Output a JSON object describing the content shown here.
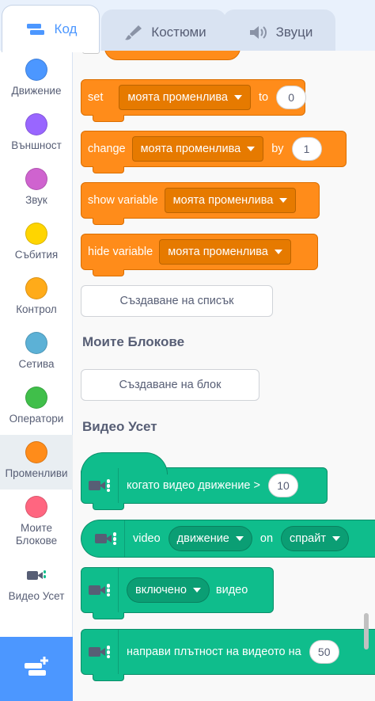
{
  "tabs": [
    {
      "label": "Код",
      "icon": "code-icon",
      "active": true
    },
    {
      "label": "Костюми",
      "icon": "brush-icon",
      "active": false
    },
    {
      "label": "Звуци",
      "icon": "speaker-icon",
      "active": false
    }
  ],
  "categories": [
    {
      "label": "Движение",
      "color": "#4c97ff"
    },
    {
      "label": "Външност",
      "color": "#9966ff"
    },
    {
      "label": "Звук",
      "color": "#cf63cf"
    },
    {
      "label": "Събития",
      "color": "#ffd500"
    },
    {
      "label": "Контрол",
      "color": "#ffab19"
    },
    {
      "label": "Сетива",
      "color": "#5cb1d6"
    },
    {
      "label": "Оператори",
      "color": "#40bf4a"
    },
    {
      "label": "Променливи",
      "color": "#ff8c1a"
    },
    {
      "label": "Моите Блокове",
      "color": "#ff6680"
    },
    {
      "label": "Видео Усет",
      "color": ""
    }
  ],
  "variable_blocks": {
    "set": {
      "keyword": "set",
      "variable": "моята променлива",
      "joiner": "to",
      "value": "0"
    },
    "change": {
      "keyword": "change",
      "variable": "моята променлива",
      "joiner": "by",
      "value": "1"
    },
    "show": {
      "keyword": "show variable",
      "variable": "моята променлива"
    },
    "hide": {
      "keyword": "hide variable",
      "variable": "моята променлива"
    }
  },
  "buttons": {
    "make_list": "Създаване на списък",
    "make_block": "Създаване на блок"
  },
  "headings": {
    "my_blocks": "Моите Блокове",
    "video_sensing": "Видео Усет"
  },
  "video_blocks": {
    "when_motion": {
      "text": "когато видео движение >",
      "value": "10"
    },
    "video_on": {
      "keyword": "video",
      "attribute": "движение",
      "joiner": "on",
      "target": "спрайт"
    },
    "turn_video": {
      "state": "включено",
      "suffix": "видео"
    },
    "transparency": {
      "text": "направи плътност на видеото на",
      "value": "50"
    }
  },
  "colors": {
    "accent": "#4c97ff",
    "variables": "#ff8c1a",
    "video_sensing": "#0fbd8c"
  }
}
